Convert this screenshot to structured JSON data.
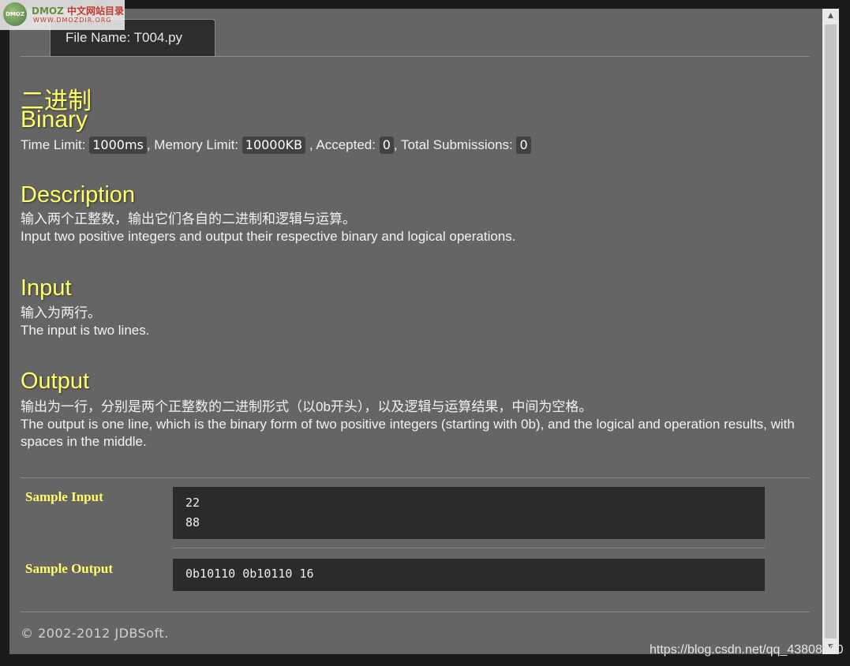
{
  "logo": {
    "mark": "DMOZ",
    "title_en": "DMOZ",
    "title_cn": "中文网站目录",
    "subtitle": "WWW.DMOZDIR.ORG"
  },
  "tab": {
    "label": "File Name:  T004.py"
  },
  "problem": {
    "title_cn": "二进制",
    "title_en": "Binary",
    "limits": {
      "time_label": "Time Limit: ",
      "time_value": "1000ms",
      "memory_label": ", Memory Limit: ",
      "memory_value": "10000KB",
      "accepted_label": " , Accepted: ",
      "accepted_value": "0",
      "total_label": ", Total Submissions: ",
      "total_value": "0"
    }
  },
  "description": {
    "heading": "Description",
    "text_cn": "输入两个正整数，输出它们各自的二进制和逻辑与运算。",
    "text_en": "Input two positive integers and output their respective binary and logical operations."
  },
  "input": {
    "heading": "Input",
    "text_cn": "输入为两行。",
    "text_en": "The input is two lines."
  },
  "output": {
    "heading": "Output",
    "text_cn": "输出为一行，分别是两个正整数的二进制形式（以0b开头），以及逻辑与运算结果，中间为空格。",
    "text_en": "The output is one line, which is the binary form of two positive integers (starting with 0b), and the logical and operation results, with spaces in the middle."
  },
  "samples": {
    "input_label": "Sample Input",
    "input_lines": [
      "22",
      "88"
    ],
    "output_label": "Sample Output",
    "output_lines": [
      "0b10110 0b10110 16"
    ]
  },
  "footer": {
    "text": "© 2002-2012  JDBSoft."
  },
  "watermark": {
    "text": "https://blog.csdn.net/qq_43808700"
  },
  "scrollbar": {
    "up_glyph": "▲",
    "down_glyph": "▼"
  }
}
